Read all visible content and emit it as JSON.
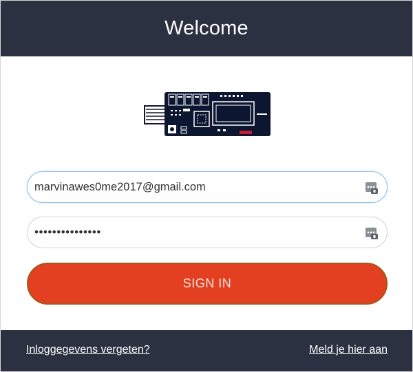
{
  "header": {
    "title": "Welcome"
  },
  "logo": {
    "icon": "usb-security-key-image",
    "colors": {
      "board": "#0c1630",
      "trace": "#ffffff",
      "chip": "#c3202f"
    }
  },
  "login": {
    "email_value": "marvinawes0me2017@gmail.com",
    "password_value": "•••••••••••••••",
    "password_manager_icon": "password-manager-icon",
    "signin_label": "SIGN IN"
  },
  "footer": {
    "forgot_label": "Inloggegevens vergeten?",
    "register_label": "Meld je hier aan"
  },
  "colors": {
    "header_bg": "#2b3141",
    "button_bg": "#e33f21",
    "footer_bg": "#2b3141"
  }
}
